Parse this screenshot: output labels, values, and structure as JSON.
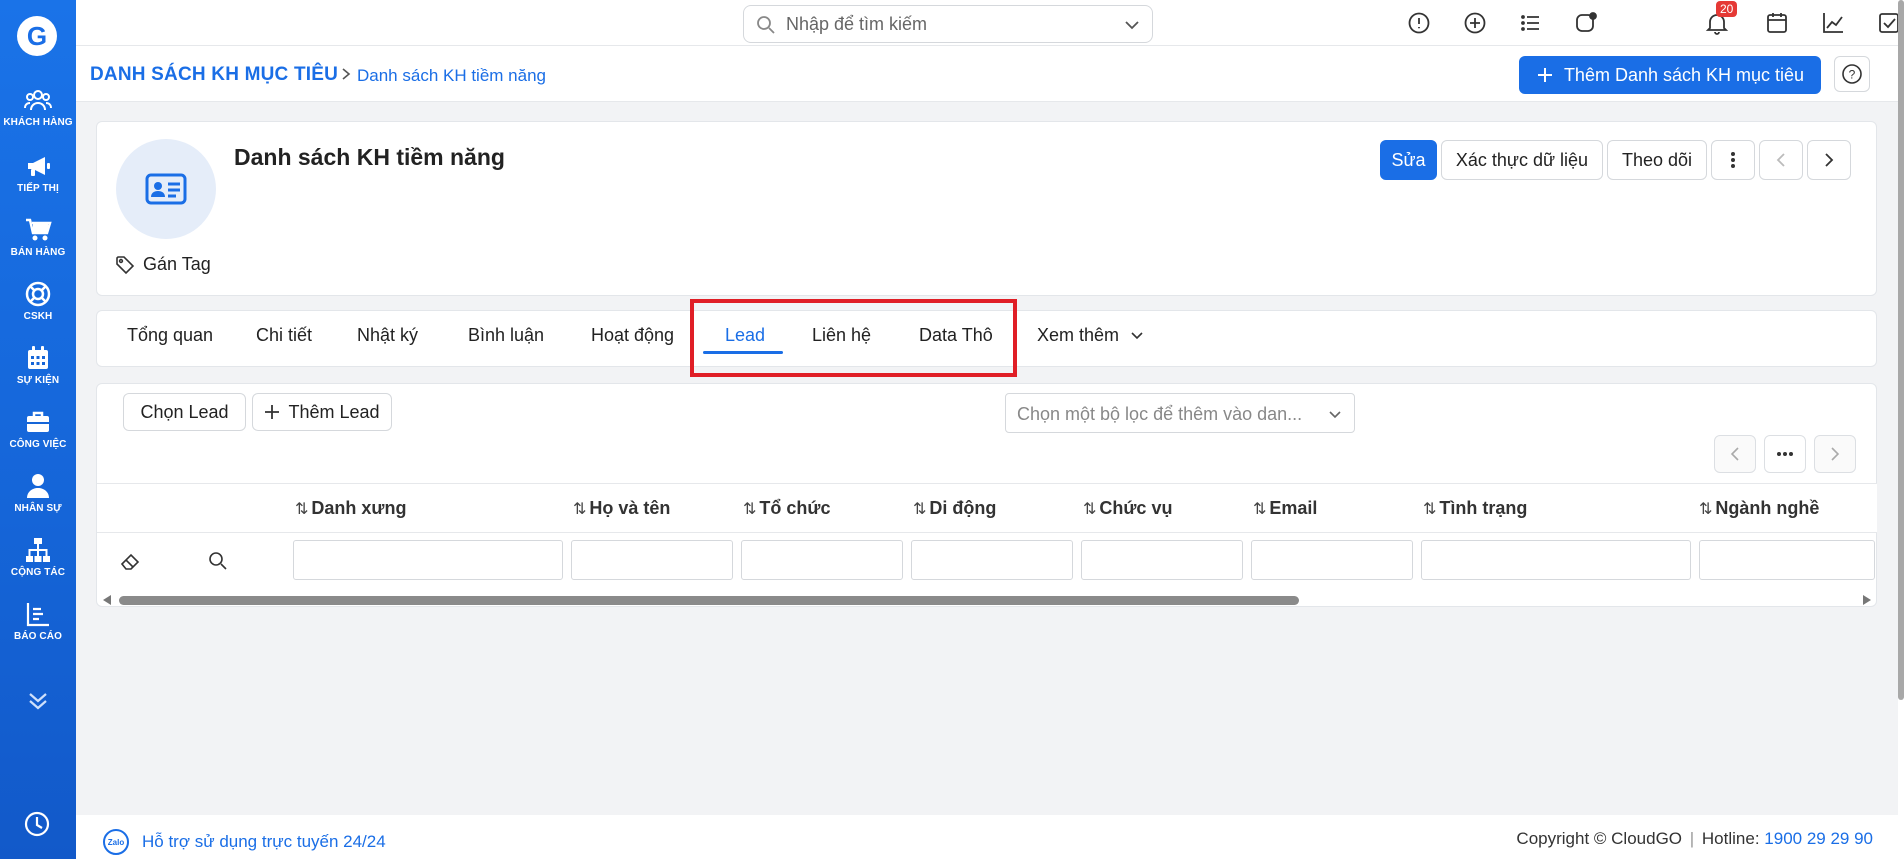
{
  "sidebar": {
    "logo": "G",
    "items": [
      {
        "label": "KHÁCH HÀNG",
        "icon": "customers-icon"
      },
      {
        "label": "TIẾP THỊ",
        "icon": "megaphone-icon"
      },
      {
        "label": "BÁN HÀNG",
        "icon": "cart-icon"
      },
      {
        "label": "CSKH",
        "icon": "lifebuoy-icon"
      },
      {
        "label": "SỰ KIỆN",
        "icon": "calendar-icon"
      },
      {
        "label": "CÔNG VIỆC",
        "icon": "briefcase-icon"
      },
      {
        "label": "NHÂN SỰ",
        "icon": "person-icon"
      },
      {
        "label": "CỘNG TÁC",
        "icon": "org-chart-icon"
      },
      {
        "label": "BÁO CÁO",
        "icon": "report-icon"
      }
    ]
  },
  "topbar": {
    "search_placeholder": "Nhập để tìm kiếm",
    "notification_count": "20"
  },
  "breadcrumb": {
    "root": "DANH SÁCH KH MỤC TIÊU",
    "current": "Danh sách KH tiềm năng"
  },
  "header_actions": {
    "add_button": "Thêm Danh sách KH mục tiêu",
    "help": "?"
  },
  "record": {
    "title": "Danh sách KH tiềm năng",
    "tag_label": "Gán Tag",
    "edit": "Sửa",
    "verify": "Xác thực dữ liệu",
    "follow": "Theo dõi"
  },
  "tabs": [
    {
      "label": "Tổng quan"
    },
    {
      "label": "Chi tiết"
    },
    {
      "label": "Nhật ký"
    },
    {
      "label": "Bình luận"
    },
    {
      "label": "Hoạt động"
    },
    {
      "label": "Lead"
    },
    {
      "label": "Liên hệ"
    },
    {
      "label": "Data Thô"
    },
    {
      "label": "Xem thêm"
    }
  ],
  "related": {
    "select_lead": "Chọn Lead",
    "add_lead": "Thêm Lead",
    "filter_placeholder": "Chọn một bộ lọc để thêm vào dan...",
    "columns": [
      "Danh xưng",
      "Họ và tên",
      "Tổ chức",
      "Di động",
      "Chức vụ",
      "Email",
      "Tình trạng",
      "Ngành nghề"
    ]
  },
  "footer": {
    "zalo": "Zalo",
    "support": "Hỗ trợ sử dụng trực tuyến 24/24",
    "copyright": "Copyright © CloudGO",
    "hotline_label": "Hotline:",
    "hotline": "1900 29 29 90"
  },
  "colors": {
    "brand": "#1a6ee6",
    "highlight": "#e01e26",
    "badge": "#e53935"
  }
}
